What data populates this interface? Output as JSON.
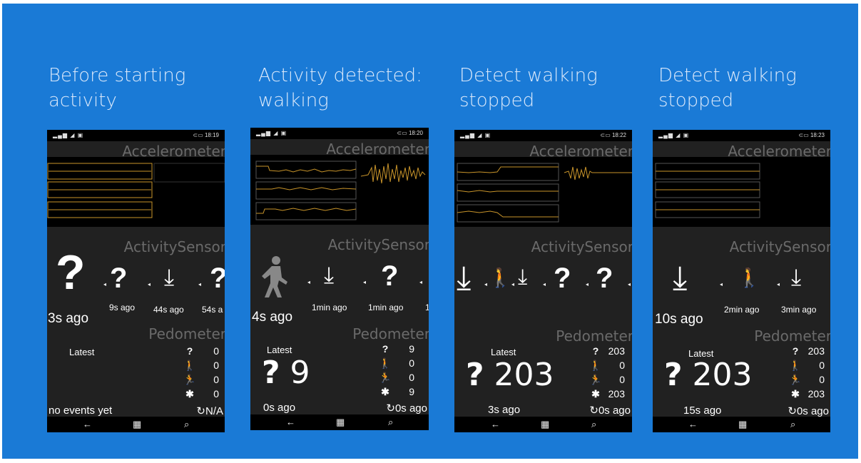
{
  "captions": [
    "Before starting\nactivity",
    "Activity detected:\nwalking",
    "Detect walking\nstopped",
    "Detect walking\nstopped"
  ],
  "phones": [
    {
      "time": "18:19",
      "accel_header": "Accelerometer",
      "activity_header": "ActivitySensor",
      "pedometer_header": "Pedometer",
      "latest_label": "Latest",
      "big_count": "",
      "bottom_left": "no events yet",
      "bottom_right": "N/A",
      "activity_times": [
        "3s ago",
        "9s ago",
        "44s ago",
        "54s a"
      ],
      "stats": [
        "0",
        "0",
        "0",
        "0"
      ]
    },
    {
      "time": "18:20",
      "accel_header": "Accelerometer",
      "activity_header": "ActivitySensor",
      "pedometer_header": "Pedometer",
      "latest_label": "Latest",
      "big_count": "9",
      "bottom_left": "0s ago",
      "bottom_right": "0s ago",
      "activity_times": [
        "4s ago",
        "1min ago",
        "1min ago",
        "1"
      ],
      "stats": [
        "9",
        "0",
        "0",
        "9"
      ]
    },
    {
      "time": "18:22",
      "accel_header": "Accelerometer",
      "activity_header": "ActivitySensor",
      "pedometer_header": "Pedometer",
      "latest_label": "Latest",
      "big_count": "203",
      "bottom_left": "3s ago",
      "bottom_right": "0s ago",
      "activity_times": [],
      "stats": [
        "203",
        "0",
        "0",
        "203"
      ]
    },
    {
      "time": "18:23",
      "accel_header": "Accelerometer",
      "activity_header": "ActivitySensor",
      "pedometer_header": "Pedometer",
      "latest_label": "Latest",
      "big_count": "203",
      "bottom_left": "15s ago",
      "bottom_right": "0s ago",
      "activity_times": [
        "10s ago",
        "2min ago",
        "3min ago"
      ],
      "stats": [
        "203",
        "0",
        "0",
        "203"
      ]
    }
  ],
  "icons": {
    "unknown": "question-mark-icon",
    "stationary": "stationary-icon",
    "walking": "walking-icon",
    "running": "running-icon",
    "steps_total": "asterisk-icon",
    "refresh": "refresh-icon"
  },
  "colors": {
    "background": "#1a7ad6",
    "phone": "#212121",
    "trace": "#c8942a"
  }
}
